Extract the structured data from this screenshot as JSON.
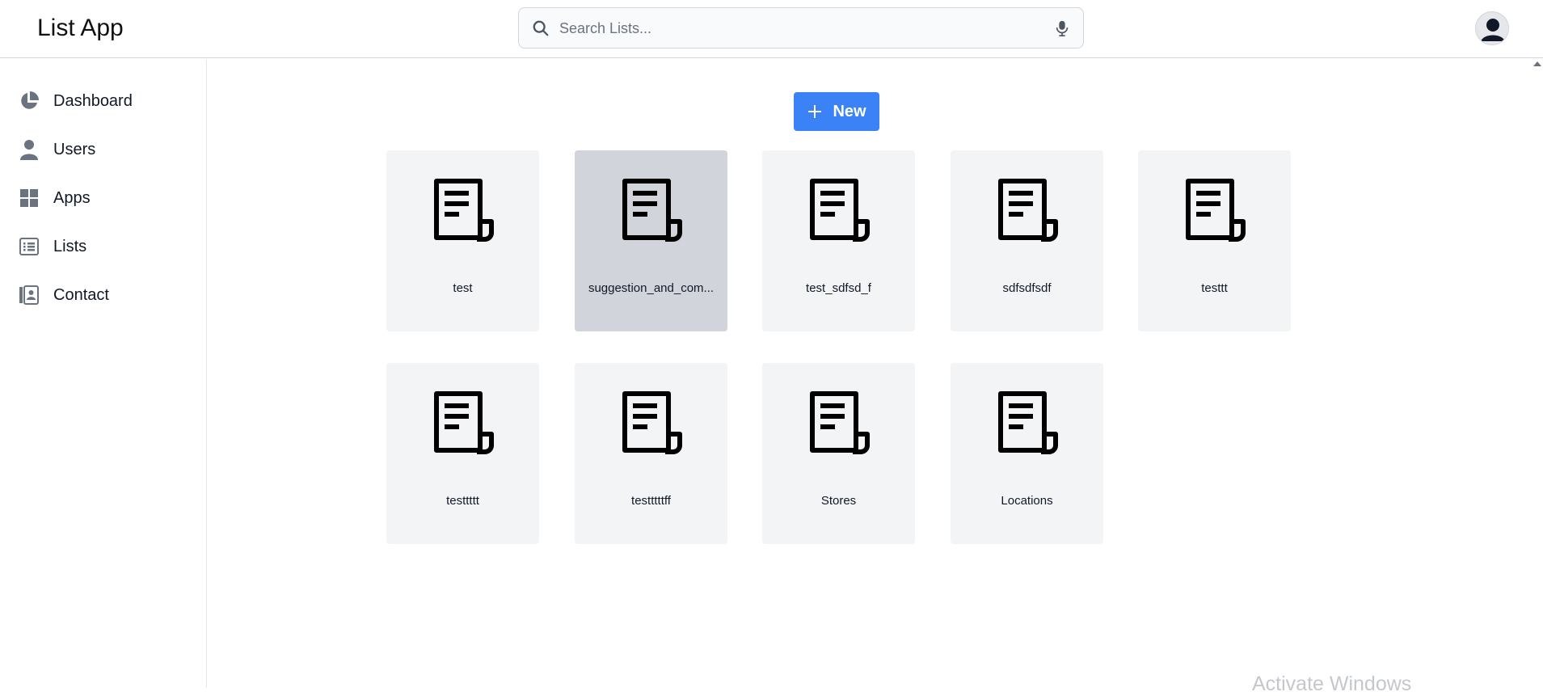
{
  "header": {
    "title": "List App",
    "search": {
      "placeholder": "Search Lists...",
      "value": ""
    },
    "avatar_icon": "user-circle-icon"
  },
  "sidebar": {
    "items": [
      {
        "label": "Dashboard",
        "icon": "pie-chart-icon"
      },
      {
        "label": "Users",
        "icon": "user-icon"
      },
      {
        "label": "Apps",
        "icon": "grid-icon"
      },
      {
        "label": "Lists",
        "icon": "list-icon"
      },
      {
        "label": "Contact",
        "icon": "contact-book-icon"
      }
    ]
  },
  "main": {
    "new_button_label": "New",
    "cards": [
      {
        "label": "test",
        "selected": false
      },
      {
        "label": "suggestion_and_com...",
        "selected": true
      },
      {
        "label": "test_sdfsd_f",
        "selected": false
      },
      {
        "label": "sdfsdfsdf",
        "selected": false
      },
      {
        "label": "testtt",
        "selected": false
      },
      {
        "label": "testtttt",
        "selected": false
      },
      {
        "label": "testttttff",
        "selected": false
      },
      {
        "label": "Stores",
        "selected": false
      },
      {
        "label": "Locations",
        "selected": false
      }
    ]
  },
  "system": {
    "watermark": "Activate Windows"
  },
  "colors": {
    "accent": "#3b82f6",
    "card_bg": "#f3f4f6",
    "card_selected_bg": "#d1d5db",
    "icon_gray": "#6b7280"
  }
}
